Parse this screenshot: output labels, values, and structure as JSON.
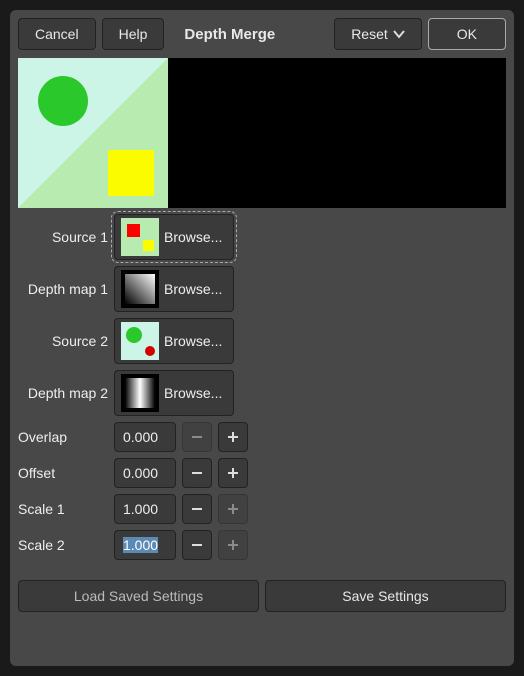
{
  "topbar": {
    "cancel": "Cancel",
    "help": "Help",
    "title": "Depth Merge",
    "reset": "Reset",
    "ok": "OK"
  },
  "rows": {
    "source1": {
      "label": "Source 1",
      "button": "Browse..."
    },
    "depthmap1": {
      "label": "Depth map 1",
      "button": "Browse..."
    },
    "source2": {
      "label": "Source 2",
      "button": "Browse..."
    },
    "depthmap2": {
      "label": "Depth map 2",
      "button": "Browse..."
    }
  },
  "params": {
    "overlap": {
      "label": "Overlap",
      "value": "0.000"
    },
    "offset": {
      "label": "Offset",
      "value": "0.000"
    },
    "scale1": {
      "label": "Scale 1",
      "value": "1.000"
    },
    "scale2": {
      "label": "Scale 2",
      "value": "1.000"
    }
  },
  "bottom": {
    "load": "Load Saved Settings",
    "save": "Save Settings"
  }
}
